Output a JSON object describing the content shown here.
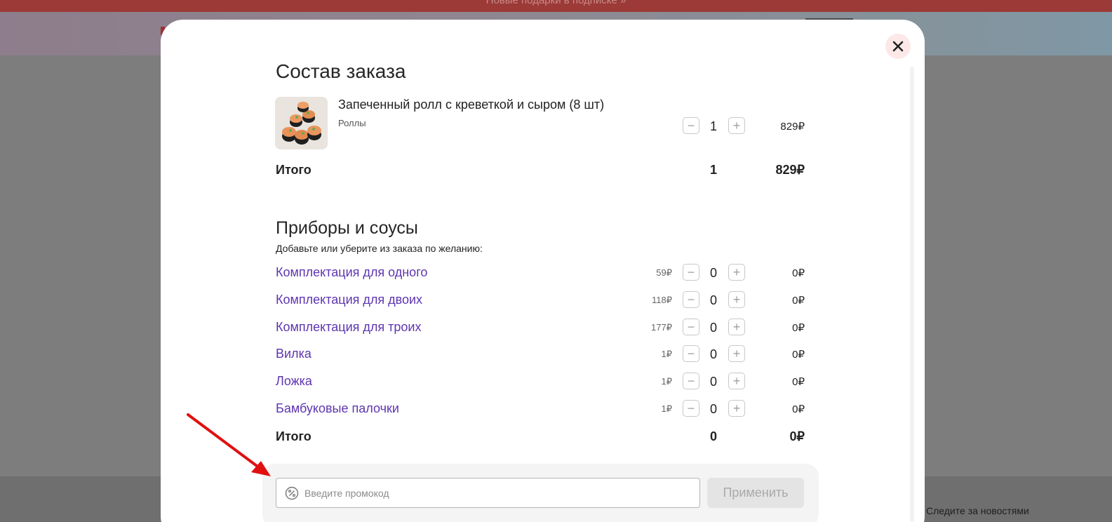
{
  "banner": {
    "text": "Новые подарки в подписке »"
  },
  "footer": {
    "text": "Следите за новостями"
  },
  "modal": {
    "order_title": "Состав заказа",
    "product": {
      "name": "Запеченный ролл с креветкой и сыром (8 шт)",
      "category": "Роллы",
      "qty": "1",
      "price": "829₽"
    },
    "order_total": {
      "label": "Итого",
      "qty": "1",
      "sum": "829₽"
    },
    "accessories_title": "Приборы и соусы",
    "accessories_subtitle": "Добавьте или уберите из заказа по желанию:",
    "accessories": [
      {
        "name": "Комплектация для одного",
        "unit_price": "59₽",
        "qty": "0",
        "total": "0₽"
      },
      {
        "name": "Комплектация для двоих",
        "unit_price": "118₽",
        "qty": "0",
        "total": "0₽"
      },
      {
        "name": "Комплектация для троих",
        "unit_price": "177₽",
        "qty": "0",
        "total": "0₽"
      },
      {
        "name": "Вилка",
        "unit_price": "1₽",
        "qty": "0",
        "total": "0₽"
      },
      {
        "name": "Ложка",
        "unit_price": "1₽",
        "qty": "0",
        "total": "0₽"
      },
      {
        "name": "Бамбуковые палочки",
        "unit_price": "1₽",
        "qty": "0",
        "total": "0₽"
      }
    ],
    "accessories_total": {
      "label": "Итого",
      "qty": "0",
      "sum": "0₽"
    },
    "promo": {
      "placeholder": "Введите промокод",
      "apply_label": "Применить"
    }
  },
  "colors": {
    "accent_link": "#5e35b1",
    "banner": "#9b3a37",
    "annotation_arrow": "#e01010"
  },
  "icons": {
    "close": "close-icon",
    "promo": "percent-icon",
    "minus": "minus-icon",
    "plus": "plus-icon"
  }
}
